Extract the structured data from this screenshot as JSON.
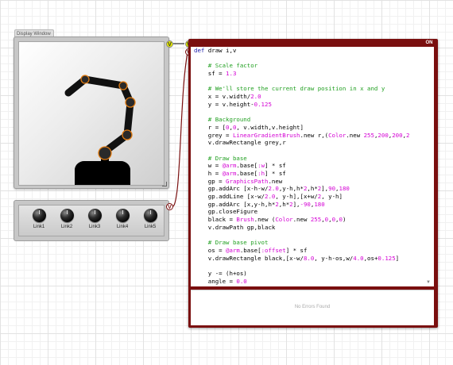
{
  "display_window": {
    "title": "Display Window"
  },
  "knobs": [
    {
      "label": "Link1"
    },
    {
      "label": "Link2"
    },
    {
      "label": "Link3"
    },
    {
      "label": "Link4"
    },
    {
      "label": "Link5"
    }
  ],
  "ports": {
    "display_out": "V",
    "editor_in_1": "V",
    "editor_in_2": "V",
    "knobs_out": "V"
  },
  "editor": {
    "on_label": "ON",
    "status": "No Errors Found",
    "code_lines": [
      "def draw i,v",
      "",
      "    # Scale factor",
      "    sf = 1.3",
      "",
      "    # We'll store the current draw position in x and y",
      "    x = v.width/2.0",
      "    y = v.height-0.125",
      "",
      "    # Background",
      "    r = [0,0, v.width,v.height]",
      "    grey = LinearGradientBrush.new r,(Color.new 255,200,200,2",
      "    v.drawRectangle grey,r",
      "",
      "    # Draw base",
      "    w = @arm.base[:w] * sf",
      "    h = @arm.base[:h] * sf",
      "    gp = GraphicsPath.new",
      "    gp.addArc [x-h-w/2.0,y-h,h*2,h*2],90,180",
      "    gp.addLine [x-w/2.0, y-h],[x+w/2, y-h]",
      "    gp.addArc [x,y-h,h*2,h*2],-90,180",
      "    gp.closeFigure",
      "    black = Brush.new (Color.new 255,0,0,0)",
      "    v.drawPath gp,black",
      "",
      "    # Draw base pivot",
      "    os = @arm.base[:offset] * sf",
      "    v.drawRectangle black,[x-w/8.0, y-h-os,w/4.0,os+0.125]",
      "",
      "    y -= (h+os)",
      "    angle = 0.0"
    ]
  },
  "colors": {
    "editor_frame": "#7a0f0f",
    "comment": "#22a022",
    "number": "#d400d4",
    "keyword": "#1a1aaa",
    "joint": "#e07a10",
    "port_yellow": "#e3e800"
  }
}
